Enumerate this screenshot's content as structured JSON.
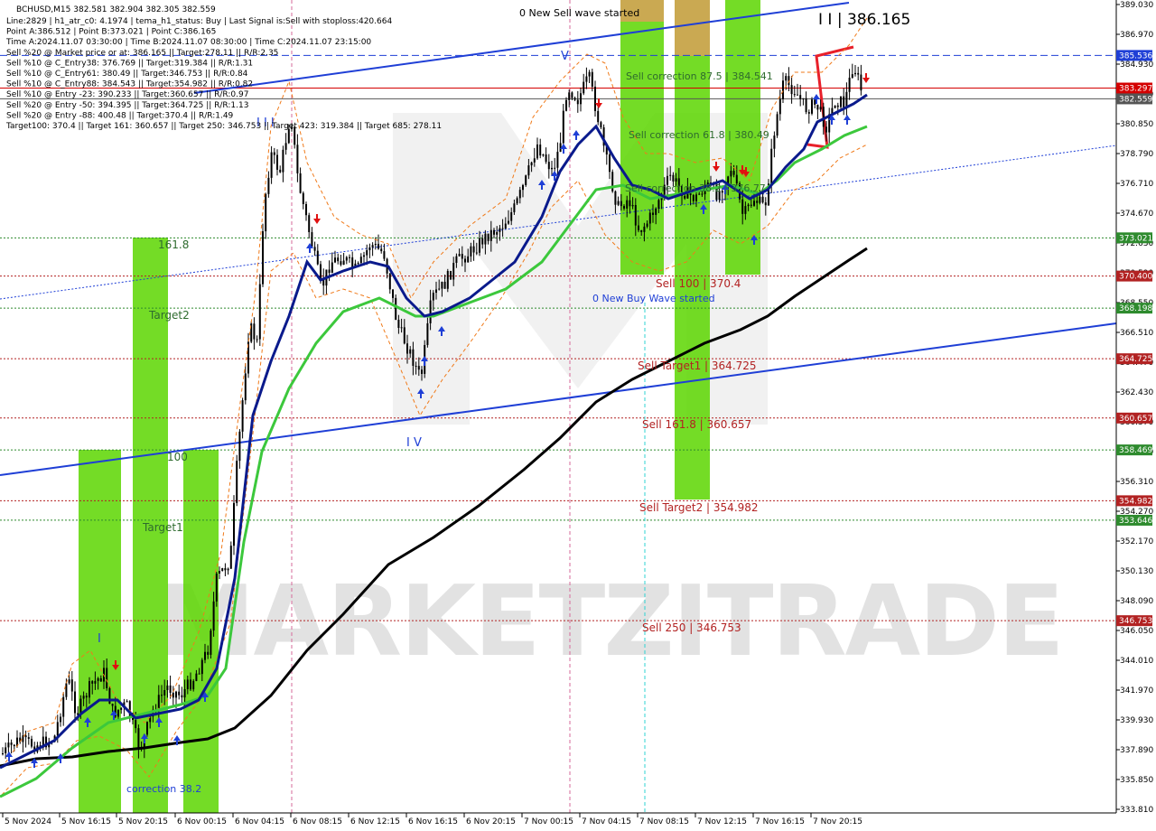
{
  "header": {
    "symbol": "BCHUSD,M15  382.581 382.904 382.305 382.559",
    "lines": [
      "Line:2829 | h1_atr_c0: 4.1974 | tema_h1_status: Buy | Last Signal is:Sell with stoploss:420.664",
      "Point A:386.512 | Point B:373.021 | Point C:386.165",
      "Time A:2024.11.07 03:30:00 | Time B:2024.11.07 08:30:00 | Time C:2024.11.07 23:15:00",
      "Sell %20 @ Market price or at: 386.165 || Target:278.11 || R/R:2.35",
      "Sell %10 @ C_Entry38: 376.769 || Target:319.384 || R/R:1.31",
      "Sell %10 @ C_Entry61: 380.49 || Target:346.753 || R/R:0.84",
      "Sell %10 @ C_Entry88: 384.543 || Target:354.982 || R/R:0.82",
      "Sell %10 @ Entry -23: 390.233 || Target:360.657 || R/R:0.97",
      "Sell %20 @ Entry -50: 394.395 || Target:364.725 || R/R:1.13",
      "Sell %20 @ Entry -88: 400.48 || Target:370.4 || R/R:1.49",
      "Target100: 370.4 || Target 161: 360.657 || Target 250: 346.753 || Target 423: 319.384 || Target 685: 278.11"
    ]
  },
  "chart_data": {
    "type": "candlestick",
    "symbol": "BCHUSD",
    "timeframe": "M15",
    "y_axis": {
      "range": [
        333.63,
        389.03
      ],
      "ticks": [
        "389.030",
        "386.970",
        "384.930",
        "382.890",
        "380.850",
        "378.790",
        "376.710",
        "374.670",
        "372.630",
        "370.590",
        "368.550",
        "366.510",
        "364.470",
        "362.430",
        "360.370",
        "358.330",
        "356.310",
        "354.270",
        "352.170",
        "350.130",
        "348.090",
        "346.050",
        "344.010",
        "341.970",
        "339.930",
        "337.890",
        "335.850",
        "333.810"
      ]
    },
    "x_axis": {
      "labels": [
        "5 Nov 2024",
        "5 Nov 16:15",
        "5 Nov 20:15",
        "6 Nov 00:15",
        "6 Nov 04:15",
        "6 Nov 08:15",
        "6 Nov 12:15",
        "6 Nov 16:15",
        "6 Nov 20:15",
        "7 Nov 00:15",
        "7 Nov 04:15",
        "7 Nov 08:15",
        "7 Nov 12:15",
        "7 Nov 16:15",
        "7 Nov 20:15"
      ]
    },
    "price_levels": [
      {
        "value": 385.536,
        "label": "385.536",
        "color": "#1f3fd6",
        "style": "dashed"
      },
      {
        "value": 383.297,
        "label": "383.297",
        "color": "#d40000",
        "style": "solid"
      },
      {
        "value": 382.559,
        "label": "382.559",
        "color": "#555555",
        "style": "solid"
      },
      {
        "value": 373.021,
        "label": "373.021",
        "color": "#2e8b2e",
        "style": "dotted"
      },
      {
        "value": 370.4,
        "label": "370.400",
        "color": "#b22222",
        "style": "dotted"
      },
      {
        "value": 368.198,
        "label": "368.198",
        "color": "#2e8b2e",
        "style": "dotted"
      },
      {
        "value": 364.725,
        "label": "364.725",
        "color": "#b22222",
        "style": "dotted"
      },
      {
        "value": 360.657,
        "label": "360.657",
        "color": "#b22222",
        "style": "dotted"
      },
      {
        "value": 358.469,
        "label": "358.469",
        "color": "#2e8b2e",
        "style": "dotted"
      },
      {
        "value": 354.982,
        "label": "354.982",
        "color": "#b22222",
        "style": "dotted"
      },
      {
        "value": 353.646,
        "label": "353.646",
        "color": "#2e8b2e",
        "style": "dotted"
      },
      {
        "value": 346.753,
        "label": "346.753",
        "color": "#b22222",
        "style": "dotted"
      }
    ],
    "zone_labels": [
      {
        "text": "0 New Sell wave started",
        "color": "#000000"
      },
      {
        "text": "I I | 386.165",
        "color": "#000000"
      },
      {
        "text": "Sell correction 87.5 | 384.541",
        "color": "#2e6b2e"
      },
      {
        "text": "Sell correction 61.8 | 380.49",
        "color": "#2e6b2e"
      },
      {
        "text": "Sell correction 38.2 | 376.77",
        "color": "#2e6b2e"
      },
      {
        "text": "161.8",
        "color": "#2e6b2e"
      },
      {
        "text": "Target2",
        "color": "#2e6b2e"
      },
      {
        "text": "100",
        "color": "#2e6b2e"
      },
      {
        "text": "Target1",
        "color": "#2e6b2e"
      },
      {
        "text": "correction 38.2",
        "color": "#1f3fd6"
      },
      {
        "text": "Sell 100 | 370.4",
        "color": "#b22222"
      },
      {
        "text": "0 New Buy Wave started",
        "color": "#1f3fd6"
      },
      {
        "text": "Sell Target1 | 364.725",
        "color": "#b22222"
      },
      {
        "text": "Sell 161.8 | 360.657",
        "color": "#b22222"
      },
      {
        "text": "Sell Target2 | 354.982",
        "color": "#b22222"
      },
      {
        "text": "Sell  250 | 346.753",
        "color": "#b22222"
      },
      {
        "text": "I V",
        "color": "#1f3fd6"
      },
      {
        "text": "I I I",
        "color": "#1f3fd6"
      },
      {
        "text": "V",
        "color": "#1f3fd6"
      },
      {
        "text": "I",
        "color": "#1f3fd6"
      }
    ],
    "watermark": "MARKETZITRADE",
    "colors": {
      "bull_zone": "#5cd600",
      "sell_zone": "#d9a05a",
      "ma_fast": "#0a1a8c",
      "ma_mid": "#3cc83c",
      "ma_slow": "#000000",
      "trend": "#1f3fd6"
    }
  }
}
